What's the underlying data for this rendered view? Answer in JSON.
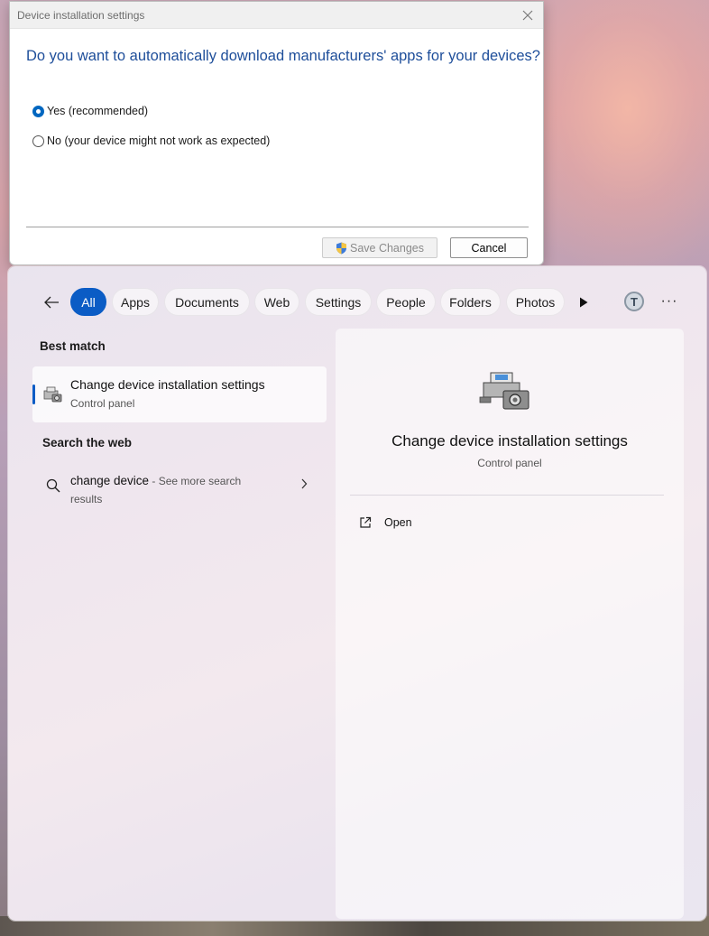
{
  "dialog": {
    "title": "Device installation settings",
    "question": "Do you want to automatically download manufacturers' apps for your devices?",
    "options": [
      {
        "label": "Yes (recommended)",
        "selected": true
      },
      {
        "label": "No (your device might not work as expected)",
        "selected": false
      }
    ],
    "save_label": "Save Changes",
    "cancel_label": "Cancel"
  },
  "search": {
    "tabs": [
      {
        "label": "All",
        "active": true
      },
      {
        "label": "Apps",
        "active": false
      },
      {
        "label": "Documents",
        "active": false
      },
      {
        "label": "Web",
        "active": false
      },
      {
        "label": "Settings",
        "active": false
      },
      {
        "label": "People",
        "active": false
      },
      {
        "label": "Folders",
        "active": false
      },
      {
        "label": "Photos",
        "active": false
      }
    ],
    "avatar_initial": "T",
    "more_label": "···",
    "best_match_heading": "Best match",
    "best_match": {
      "title": "Change device installation settings",
      "subtitle": "Control panel"
    },
    "web_heading": "Search the web",
    "web_result": {
      "query": "change device",
      "suffix": " - See more search results"
    },
    "detail": {
      "title": "Change device installation settings",
      "subtitle": "Control panel",
      "actions": [
        {
          "label": "Open",
          "icon": "open-external-icon"
        }
      ]
    }
  },
  "colors": {
    "accent": "#0b5cc5",
    "dialog_question": "#1e4e9a"
  }
}
